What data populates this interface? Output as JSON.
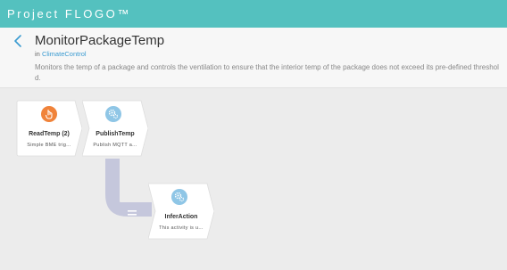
{
  "app": {
    "brand": "Project FLOGO™"
  },
  "header": {
    "title": "MonitorPackageTemp",
    "in_prefix": "in",
    "app_name": "ClimateControl",
    "description": "Monitors the temp of a package and controls the ventilation to ensure that the interior temp of the package does not exceed its pre-defined threshold."
  },
  "flow": {
    "tiles": [
      {
        "name": "ReadTemp (2)",
        "summary": "Simple BME trig...",
        "icon": "hand-touch-icon",
        "kind": "trigger"
      },
      {
        "name": "PublishTemp",
        "summary": "Publish MQTT a...",
        "icon": "gears-icon",
        "kind": "activity"
      },
      {
        "name": "InferAction",
        "summary": "This activity is u...",
        "icon": "gears-icon",
        "kind": "activity"
      }
    ],
    "branch": {
      "condition_icon": "equals-icon"
    }
  },
  "colors": {
    "topbar": "#54c1bf",
    "trigger_icon": "#f0833a",
    "activity_icon": "#8fc6e6",
    "branch": "#c5c7dc",
    "link": "#3a9bd1"
  }
}
